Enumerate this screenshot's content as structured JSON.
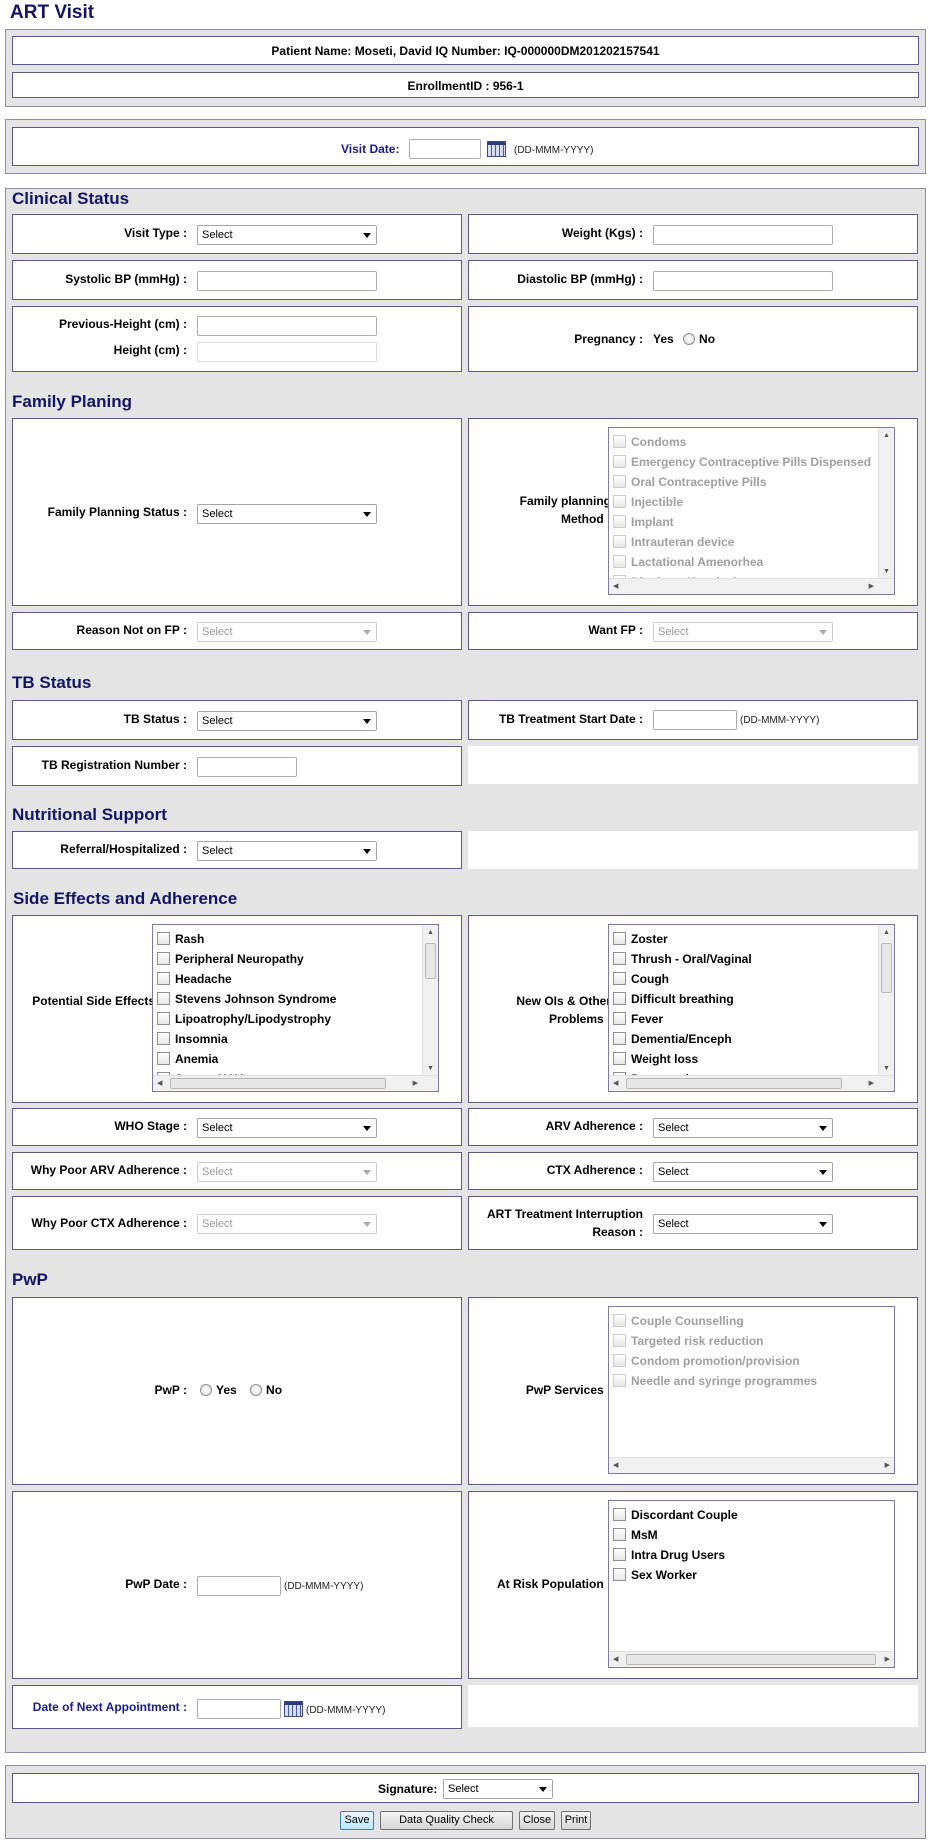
{
  "page_title": "ART Visit",
  "header": {
    "patient_line": "Patient Name: Moseti, David   IQ Number: IQ-000000DM201202157541",
    "enrollment": "EnrollmentID : 956-1"
  },
  "visit_date": {
    "label": "Visit Date:",
    "value": "",
    "hint": "(DD-MMM-YYYY)"
  },
  "clinical": {
    "title": "Clinical Status",
    "visit_type_label": "Visit Type :",
    "visit_type_value": "Select",
    "weight_label": "Weight (Kgs) :",
    "systolic_label": "Systolic BP (mmHg) :",
    "diastolic_label": "Diastolic BP (mmHg) :",
    "prev_height_label": "Previous-Height (cm) :",
    "height_label": "Height (cm) :",
    "pregnancy_label": "Pregnancy :",
    "pregnancy_yes": "Yes",
    "pregnancy_no": "No"
  },
  "family": {
    "title": "Family Planing",
    "status_label": "Family Planning Status :",
    "status_value": "Select",
    "method_label": "Family planning Method :",
    "methods": [
      "Condoms",
      "Emergency Contraceptive Pills Dispensed",
      "Oral Contraceptive Pills",
      "Injectible",
      "Implant",
      "Intrauteran device",
      "Lactational Amenorhea",
      "Diaphram/Cervical cap"
    ],
    "reason_label": "Reason Not on FP :",
    "reason_value": "Select",
    "want_label": "Want FP :",
    "want_value": "Select"
  },
  "tb": {
    "title": "TB Status",
    "status_label": "TB Status :",
    "status_value": "Select",
    "start_label": "TB Treatment Start Date :",
    "start_hint": "(DD-MMM-YYYY)",
    "reg_label": "TB Registration Number :"
  },
  "nutrition": {
    "title": "Nutritional Support",
    "referral_label": "Referral/Hospitalized :",
    "referral_value": "Select"
  },
  "side": {
    "title": "Side Effects and Adherence",
    "effects_label": "Potential Side Effects :",
    "effects": [
      "Rash",
      "Peripheral Neuropathy",
      "Headache",
      "Stevens Johnson Syndrome",
      "Lipoatrophy/Lipodystrophy",
      "Insomnia",
      "Anemia",
      "Severe N&V"
    ],
    "ois_label": "New OIs & Other Problems :",
    "ois": [
      "Zoster",
      "Thrush - Oral/Vaginal",
      "Cough",
      "Difficult breathing",
      "Fever",
      "Dementia/Enceph",
      "Weight loss",
      "Pneumonia"
    ],
    "who_label": "WHO Stage :",
    "who_value": "Select",
    "arv_label": "ARV Adherence :",
    "arv_value": "Select",
    "why_arv_label": "Why Poor ARV Adherence :",
    "why_arv_value": "Select",
    "ctx_label": "CTX Adherence :",
    "ctx_value": "Select",
    "why_ctx_label": "Why Poor CTX Adherence :",
    "why_ctx_value": "Select",
    "interrupt_label": "ART Treatment Interruption Reason :",
    "interrupt_value": "Select"
  },
  "pwp": {
    "title": "PwP",
    "pwp_label": "PwP :",
    "yes": "Yes",
    "no": "No",
    "services_label": "PwP Services :",
    "services": [
      "Couple Counselling",
      "Targeted risk reduction",
      "Condom promotion/provision",
      "Needle and syringe programmes"
    ],
    "date_label": "PwP Date :",
    "date_hint": "(DD-MMM-YYYY)",
    "risk_label": "At Risk Population :",
    "risk": [
      "Discordant Couple",
      "MsM",
      "Intra Drug Users",
      "Sex Worker"
    ],
    "next_label": "Date of Next Appointment :",
    "next_hint": "(DD-MMM-YYYY)"
  },
  "footer": {
    "signature_label": "Signature:",
    "signature_value": "Select",
    "save": "Save",
    "dqc": "Data Quality Check",
    "close": "Close",
    "print": "Print"
  }
}
